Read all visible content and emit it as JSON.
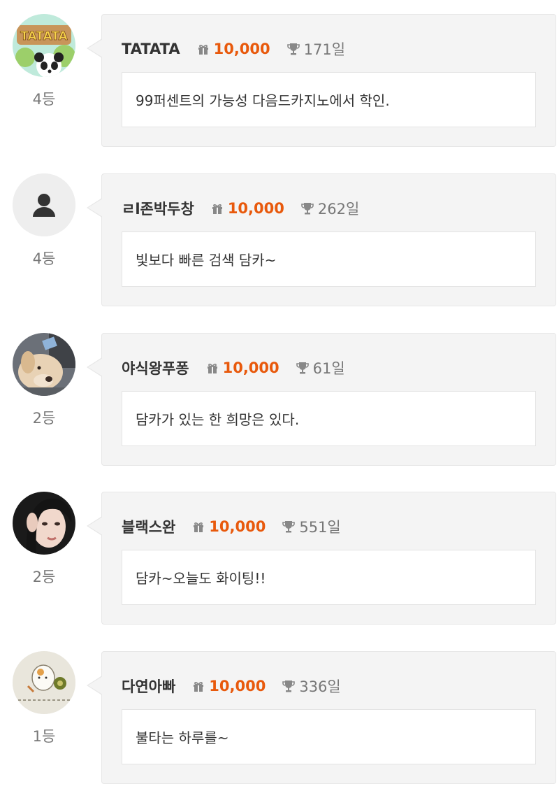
{
  "colors": {
    "points": "#e8590c",
    "nickname": "#333333",
    "muted": "#777777",
    "card_bg": "#f4f4f4",
    "message_bg": "#ffffff"
  },
  "comments": [
    {
      "avatar": "panda-sign-avatar",
      "avatar_sign_text": "TATATA",
      "rank": "4등",
      "nickname": "TATATA",
      "points": "10,000",
      "days": "171일",
      "message": "99퍼센트의 가능성 다음드카지노에서 학인."
    },
    {
      "avatar": "default-user-avatar",
      "rank": "4등",
      "nickname": "ㄹl존박두창",
      "points": "10,000",
      "days": "262일",
      "message": "빛보다 빠른 검색 담카~"
    },
    {
      "avatar": "dog-photo-avatar",
      "rank": "2등",
      "nickname": "야식왕푸퐁",
      "points": "10,000",
      "days": "61일",
      "message": "담카가 있는 한 희망은 있다."
    },
    {
      "avatar": "woman-photo-avatar",
      "rank": "2등",
      "nickname": "블랙스완",
      "points": "10,000",
      "days": "551일",
      "message": "담카~오늘도 화이팅!!"
    },
    {
      "avatar": "cartoon-sketch-avatar",
      "rank": "1등",
      "nickname": "다연아빠",
      "points": "10,000",
      "days": "336일",
      "message": "불타는 하루를~"
    }
  ]
}
